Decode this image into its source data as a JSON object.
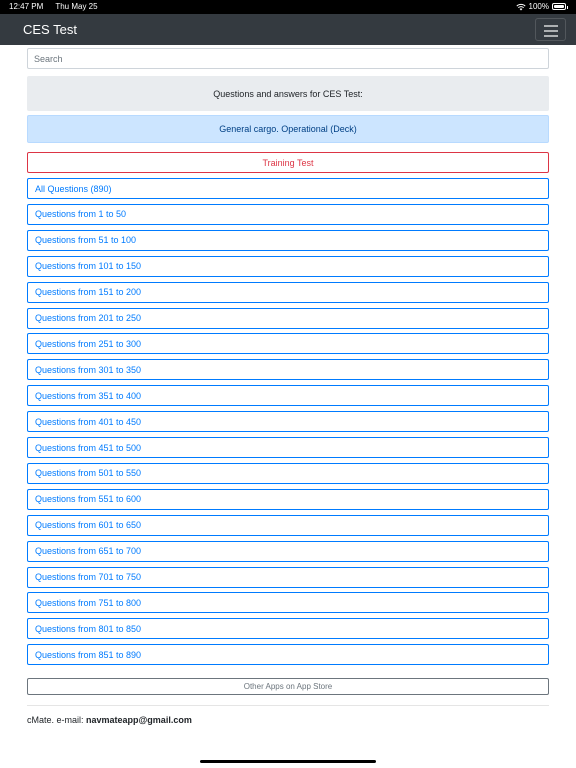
{
  "status_bar": {
    "time": "12:47 PM",
    "date": "Thu May 25",
    "battery": "100%"
  },
  "navbar": {
    "title": "CES Test",
    "menu_icon": "hamburger-icon"
  },
  "search": {
    "placeholder": "Search"
  },
  "header_text": "Questions and answers for CES Test:",
  "category": "General cargo. Operational (Deck)",
  "training_test": "Training Test",
  "question_links": [
    "All Questions (890)",
    "Questions from 1 to 50",
    "Questions from 51 to 100",
    "Questions from 101 to 150",
    "Questions from 151 to 200",
    "Questions from 201 to 250",
    "Questions from 251 to 300",
    "Questions from 301 to 350",
    "Questions from 351 to 400",
    "Questions from 401 to 450",
    "Questions from 451 to 500",
    "Questions from 501 to 550",
    "Questions from 551 to 600",
    "Questions from 601 to 650",
    "Questions from 651 to 700",
    "Questions from 701 to 750",
    "Questions from 751 to 800",
    "Questions from 801 to 850",
    "Questions from 851 to 890"
  ],
  "other_apps": "Other Apps on App Store",
  "footer": {
    "prefix": "cMate. e-mail: ",
    "email": "navmateapp@gmail.com"
  },
  "colors": {
    "primary": "#007bff",
    "danger": "#dc3545",
    "navbar": "#343a40",
    "info_bg": "#cce5ff"
  }
}
